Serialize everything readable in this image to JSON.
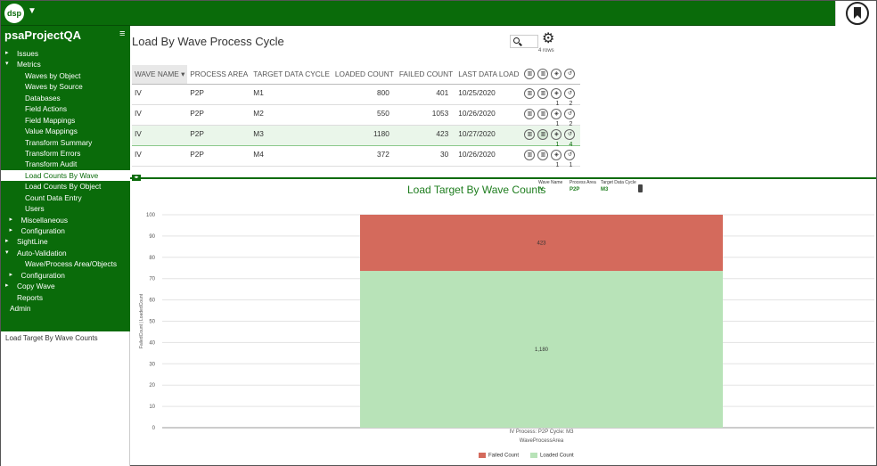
{
  "app": {
    "logo_text": "dsp",
    "project": "psaProjectQA"
  },
  "sidebar": {
    "items": [
      {
        "label": "Issues",
        "indent": 0,
        "arrow": "▸",
        "active": false
      },
      {
        "label": "Metrics",
        "indent": 0,
        "arrow": "▾",
        "active": false
      },
      {
        "label": "Waves by Object",
        "indent": 2,
        "arrow": "",
        "active": false
      },
      {
        "label": "Waves by Source",
        "indent": 2,
        "arrow": "",
        "active": false
      },
      {
        "label": "Databases",
        "indent": 2,
        "arrow": "",
        "active": false
      },
      {
        "label": "Field Actions",
        "indent": 2,
        "arrow": "",
        "active": false
      },
      {
        "label": "Field Mappings",
        "indent": 2,
        "arrow": "",
        "active": false
      },
      {
        "label": "Value Mappings",
        "indent": 2,
        "arrow": "",
        "active": false
      },
      {
        "label": "Transform Summary",
        "indent": 2,
        "arrow": "",
        "active": false
      },
      {
        "label": "Transform Errors",
        "indent": 2,
        "arrow": "",
        "active": false
      },
      {
        "label": "Transform Audit",
        "indent": 2,
        "arrow": "",
        "active": false
      },
      {
        "label": "Load Counts By Wave",
        "indent": 2,
        "arrow": "",
        "active": true
      },
      {
        "label": "Load Counts By Object",
        "indent": 2,
        "arrow": "",
        "active": false
      },
      {
        "label": "Count Data Entry",
        "indent": 2,
        "arrow": "",
        "active": false
      },
      {
        "label": "Users",
        "indent": 2,
        "arrow": "",
        "active": false
      },
      {
        "label": "Miscellaneous",
        "indent": 1,
        "arrow": "▸",
        "active": false
      },
      {
        "label": "Configuration",
        "indent": 1,
        "arrow": "▸",
        "active": false
      },
      {
        "label": "SightLine",
        "indent": 0,
        "arrow": "▸",
        "active": false
      },
      {
        "label": "Auto-Validation",
        "indent": 0,
        "arrow": "▾",
        "active": false
      },
      {
        "label": "Wave/Process Area/Objects",
        "indent": 2,
        "arrow": "",
        "active": false
      },
      {
        "label": "Configuration",
        "indent": 1,
        "arrow": "▸",
        "active": false
      },
      {
        "label": "Copy Wave",
        "indent": 0,
        "arrow": "▸",
        "active": false
      },
      {
        "label": "Reports",
        "indent": 0,
        "arrow": "",
        "active": false
      },
      {
        "label": "Admin",
        "indent": -1,
        "arrow": "",
        "active": false
      }
    ],
    "footer_label": "Load Target By Wave Counts"
  },
  "page": {
    "title": "Load By Wave Process Cycle",
    "rows_count": "4 rows"
  },
  "grid": {
    "columns": [
      "WAVE NAME ▾",
      "PROCESS AREA",
      "TARGET DATA CYCLE",
      "LOADED COUNT",
      "FAILED COUNT",
      "LAST DATA LOAD"
    ],
    "rows": [
      {
        "wave": "IV",
        "area": "P2P",
        "cycle": "M1",
        "loaded": "800",
        "failed": "401",
        "last": "10/25/2020",
        "n1": "1",
        "n2": "2",
        "selected": false
      },
      {
        "wave": "IV",
        "area": "P2P",
        "cycle": "M2",
        "loaded": "550",
        "failed": "1053",
        "last": "10/26/2020",
        "n1": "1",
        "n2": "2",
        "selected": false
      },
      {
        "wave": "IV",
        "area": "P2P",
        "cycle": "M3",
        "loaded": "1180",
        "failed": "423",
        "last": "10/27/2020",
        "n1": "1",
        "n2": "4",
        "selected": true
      },
      {
        "wave": "IV",
        "area": "P2P",
        "cycle": "M4",
        "loaded": "372",
        "failed": "30",
        "last": "10/26/2020",
        "n1": "1",
        "n2": "1",
        "selected": false
      }
    ]
  },
  "chart_header": {
    "title": "Load Target By Wave Counts",
    "filters": [
      {
        "key": "Wave Name",
        "value": "IV"
      },
      {
        "key": "Process Area",
        "value": "P2P"
      },
      {
        "key": "Target Data Cycle",
        "value": "M3"
      }
    ]
  },
  "chart_data": {
    "type": "bar",
    "stacked": true,
    "normalized_percent": true,
    "categories": [
      "IV Process: P2P Cycle: M3"
    ],
    "series": [
      {
        "name": "Loaded Count",
        "values": [
          1180
        ],
        "label": "1,180",
        "color": "#b8e3b8"
      },
      {
        "name": "Failed Count",
        "values": [
          423
        ],
        "label": "423",
        "color": "#d46a5c"
      }
    ],
    "ylim": [
      0,
      100
    ],
    "yticks": [
      0,
      10,
      20,
      30,
      40,
      50,
      60,
      70,
      80,
      90,
      100
    ],
    "xlabel": "WaveProcessArea",
    "ylabel": "FailedCount | LoadedCount",
    "grid": true,
    "legend_position": "bottom"
  }
}
